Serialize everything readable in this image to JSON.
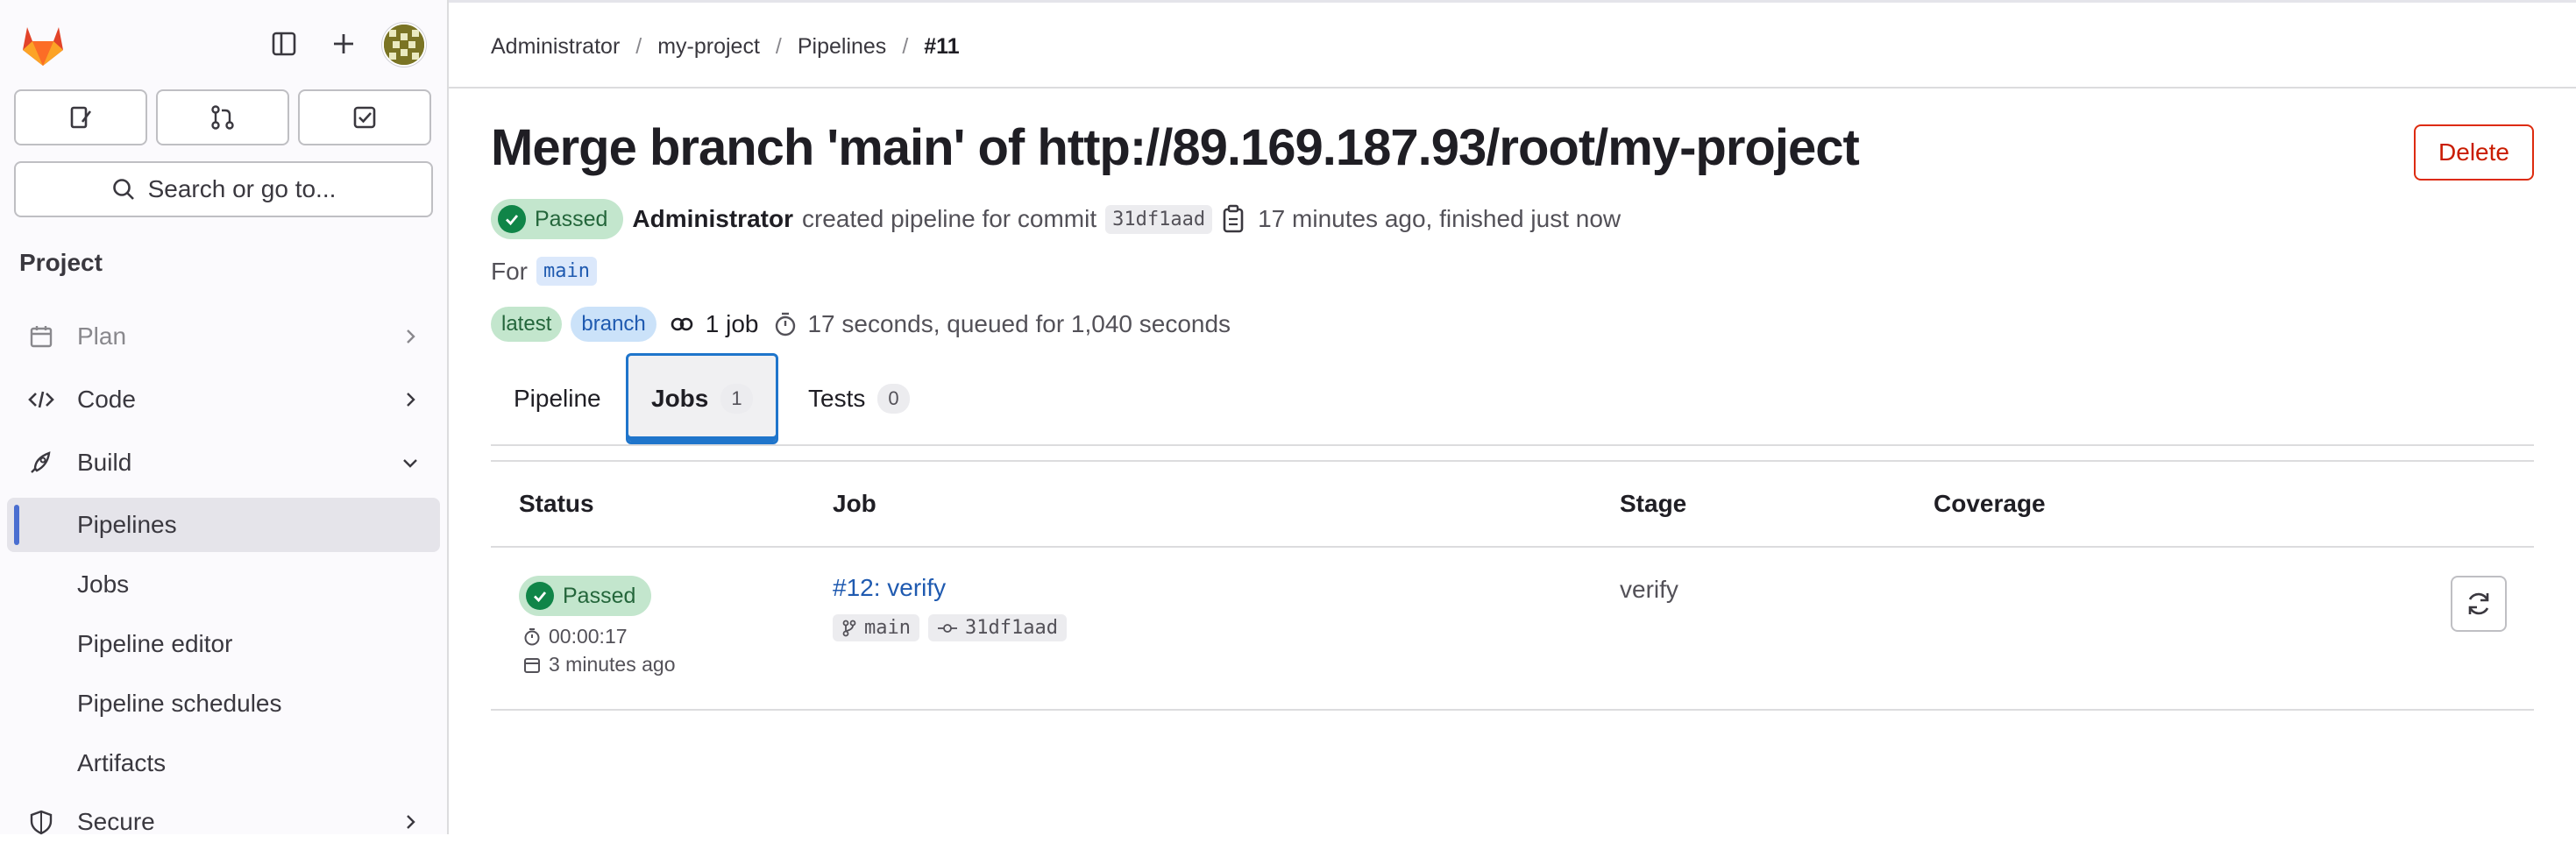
{
  "sidebar": {
    "search_placeholder": "Search or go to...",
    "section_title": "Project",
    "items": [
      {
        "label": "Plan"
      },
      {
        "label": "Code"
      },
      {
        "label": "Build"
      }
    ],
    "build_subitems": [
      {
        "label": "Pipelines"
      },
      {
        "label": "Jobs"
      },
      {
        "label": "Pipeline editor"
      },
      {
        "label": "Pipeline schedules"
      },
      {
        "label": "Artifacts"
      }
    ],
    "secure_label": "Secure"
  },
  "breadcrumb": [
    "Administrator",
    "my-project",
    "Pipelines",
    "#11"
  ],
  "page": {
    "title": "Merge branch 'main' of http://89.169.187.93/root/my-project",
    "delete_label": "Delete",
    "status": "Passed",
    "author": "Administrator",
    "created_text": "created pipeline for commit",
    "commit": "31df1aad",
    "time_text": "17 minutes ago, finished just now",
    "for_label": "For",
    "ref": "main",
    "tags": [
      "latest",
      "branch"
    ],
    "jobs_count_label": "1 job",
    "duration_text": "17 seconds, queued for 1,040 seconds"
  },
  "tabs": [
    {
      "label": "Pipeline",
      "count": ""
    },
    {
      "label": "Jobs",
      "count": "1"
    },
    {
      "label": "Tests",
      "count": "0"
    }
  ],
  "table": {
    "headers": [
      "Status",
      "Job",
      "Stage",
      "Coverage"
    ],
    "rows": [
      {
        "status": "Passed",
        "duration": "00:00:17",
        "finished": "3 minutes ago",
        "job": "#12: verify",
        "ref": "main",
        "commit": "31df1aad",
        "stage": "verify",
        "coverage": ""
      }
    ]
  },
  "colors": {
    "success": "#108548",
    "link": "#1f5ab0",
    "danger": "#dd2b0e",
    "focus": "#1f75cb"
  }
}
